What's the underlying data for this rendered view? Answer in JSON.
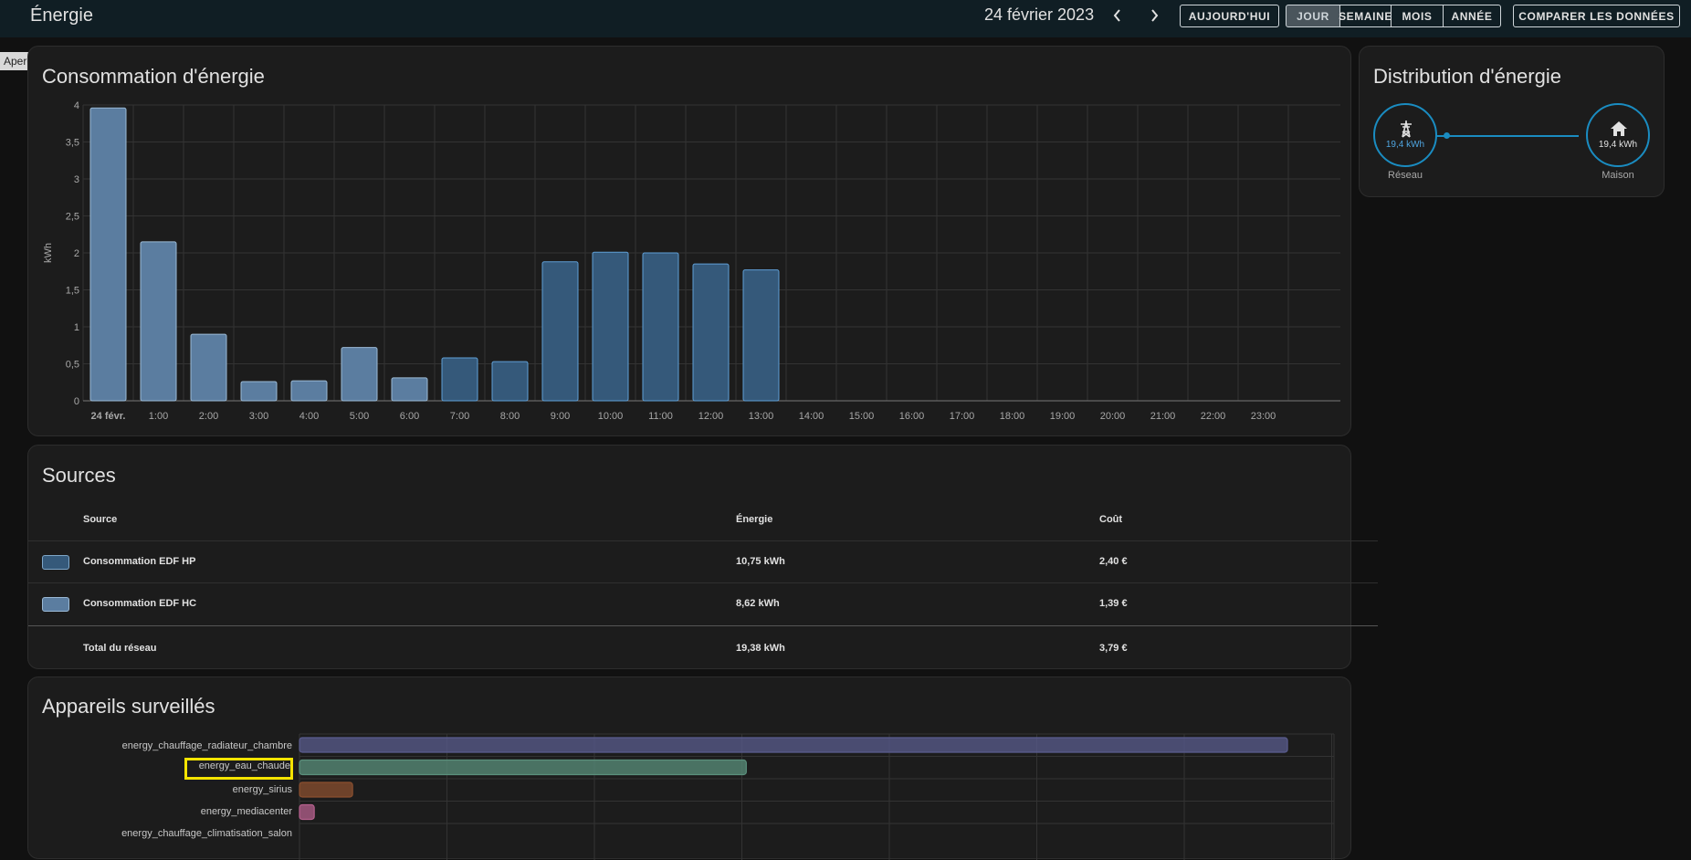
{
  "header": {
    "title": "Énergie",
    "date": "24 février 2023",
    "today_label": "AUJOURD'HUI",
    "periods": [
      "JOUR",
      "SEMAINE",
      "MOIS",
      "ANNÉE"
    ],
    "active_period": "JOUR",
    "compare_label": "COMPARER LES DONNÉES"
  },
  "tooltip": {
    "text": "Aperçu"
  },
  "consumption": {
    "title": "Consommation d'énergie",
    "chart_data": {
      "type": "bar",
      "title": "Consommation d'énergie",
      "ylabel": "kWh",
      "xlabel": "",
      "ylim": [
        0,
        4
      ],
      "yticks": [
        "0",
        "0,5",
        "1",
        "1,5",
        "2",
        "2,5",
        "3",
        "3,5",
        "4"
      ],
      "categories": [
        "24 févr.",
        "1:00",
        "2:00",
        "3:00",
        "4:00",
        "5:00",
        "6:00",
        "7:00",
        "8:00",
        "9:00",
        "10:00",
        "11:00",
        "12:00",
        "13:00",
        "14:00",
        "15:00",
        "16:00",
        "17:00",
        "18:00",
        "19:00",
        "20:00",
        "21:00",
        "22:00",
        "23:00"
      ],
      "series": [
        {
          "name": "Consommation EDF HC",
          "color": "#5b7da0",
          "values": [
            3.96,
            2.15,
            0.9,
            0.26,
            0.27,
            0.72,
            0.31,
            0,
            0,
            0,
            0,
            0,
            0,
            0,
            0,
            0,
            0,
            0,
            0,
            0,
            0,
            0,
            0,
            0
          ]
        },
        {
          "name": "Consommation EDF HP",
          "color": "#35597a",
          "values": [
            0,
            0,
            0,
            0,
            0,
            0,
            0,
            0.58,
            0.53,
            1.88,
            2.01,
            2.0,
            1.85,
            1.77,
            0,
            0,
            0,
            0,
            0,
            0,
            0,
            0,
            0,
            0
          ]
        }
      ],
      "grid": true
    }
  },
  "sources": {
    "title": "Sources",
    "columns": [
      "Source",
      "Énergie",
      "Coût"
    ],
    "rows": [
      {
        "name": "Consommation EDF HP",
        "energy": "10,75 kWh",
        "cost": "2,40 €",
        "color": "#35597a"
      },
      {
        "name": "Consommation EDF HC",
        "energy": "8,62 kWh",
        "cost": "1,39 €",
        "color": "#5b7da0"
      }
    ],
    "total": {
      "name": "Total du réseau",
      "energy": "19,38 kWh",
      "cost": "3,79 €"
    }
  },
  "distribution": {
    "title": "Distribution d'énergie",
    "grid": {
      "value": "19,4 kWh",
      "label": "Réseau",
      "icon": "transmission-tower-icon"
    },
    "home": {
      "value": "19,4 kWh",
      "label": "Maison",
      "icon": "home-icon"
    }
  },
  "devices": {
    "title": "Appareils surveillés",
    "chart_data": {
      "type": "bar",
      "orientation": "horizontal",
      "categories": [
        "energy_chauffage_radiateur_chambre",
        "energy_eau_chaude",
        "energy_sirius",
        "energy_mediacenter",
        "energy_chauffage_climatisation_salon"
      ],
      "values": [
        6.7,
        3.03,
        0.36,
        0.1,
        0
      ],
      "colors": [
        "#5a5c8e",
        "#5a8f7b",
        "#8a4f2f",
        "#b5608d",
        "#888888"
      ],
      "highlighted": "energy_eau_chaude"
    }
  }
}
